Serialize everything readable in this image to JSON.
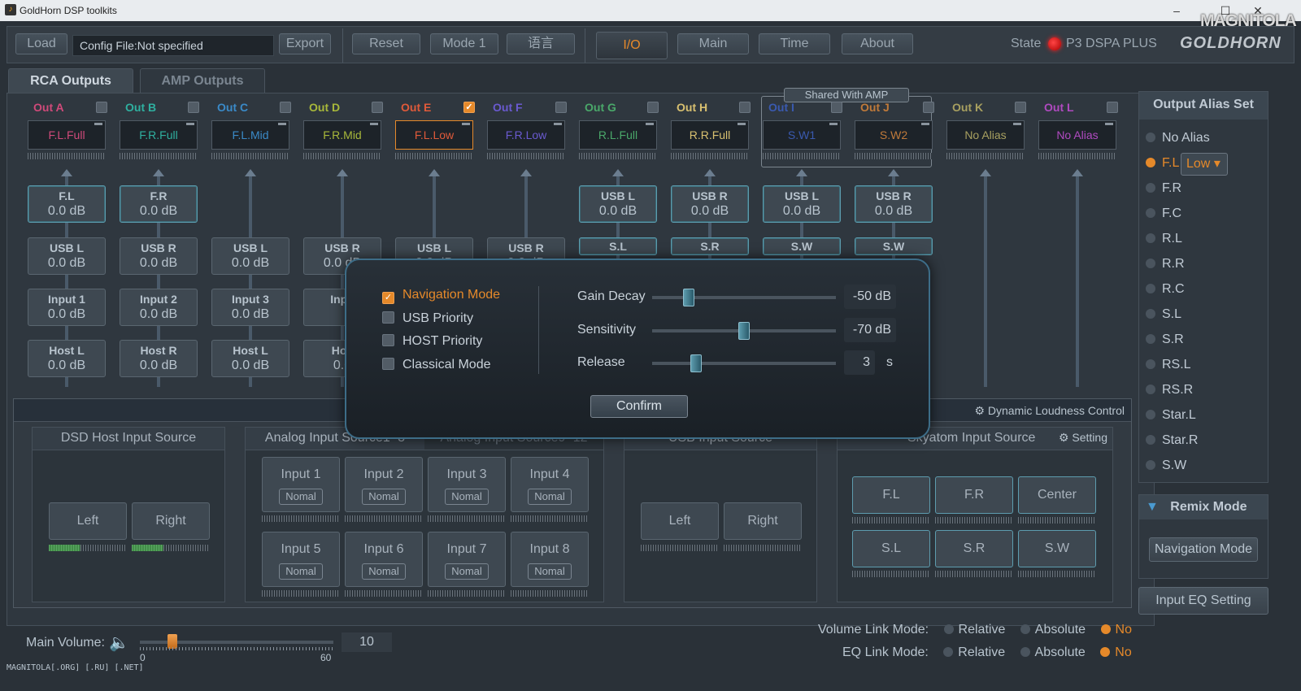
{
  "window": {
    "title": "GoldHorn DSP toolkits",
    "watermark": "MAGNITOLA"
  },
  "toolbar": {
    "load": "Load",
    "config": "Config File:Not specified",
    "export": "Export",
    "reset": "Reset",
    "mode": "Mode 1",
    "lang": "语言",
    "tabs": [
      "I/O",
      "Main",
      "Time",
      "About"
    ],
    "state_label": "State",
    "device": "P3 DSPA PLUS",
    "brand": "GOLDHORN"
  },
  "subtabs": [
    "RCA Outputs",
    "AMP Outputs"
  ],
  "shared_label": "Shared With AMP",
  "channels": [
    {
      "name": "Out  A",
      "color": "#d04a7a",
      "alias": "F.L.Full",
      "checked": false
    },
    {
      "name": "Out  B",
      "color": "#2fb0a0",
      "alias": "F.R.Full",
      "checked": false
    },
    {
      "name": "Out  C",
      "color": "#3a8ac8",
      "alias": "F.L.Mid",
      "checked": false
    },
    {
      "name": "Out  D",
      "color": "#a8b83a",
      "alias": "F.R.Mid",
      "checked": false
    },
    {
      "name": "Out  E",
      "color": "#e05a3a",
      "alias": "F.L.Low",
      "checked": true
    },
    {
      "name": "Out  F",
      "color": "#6a5ad0",
      "alias": "F.R.Low",
      "checked": false
    },
    {
      "name": "Out  G",
      "color": "#4aa86a",
      "alias": "R.L.Full",
      "checked": false
    },
    {
      "name": "Out  H",
      "color": "#d8c070",
      "alias": "R.R.Full",
      "checked": false
    },
    {
      "name": "Out  I",
      "color": "#3a5ab0",
      "alias": "S.W1",
      "checked": false
    },
    {
      "name": "Out  J",
      "color": "#c07a3a",
      "alias": "S.W2",
      "checked": false
    },
    {
      "name": "Out  K",
      "color": "#a8a060",
      "alias": "No Alias",
      "checked": false
    },
    {
      "name": "Out  L",
      "color": "#b04ac0",
      "alias": "No Alias",
      "checked": false
    }
  ],
  "sources": [
    {
      "label": "F.L",
      "value": "0.0 dB"
    },
    {
      "label": "F.R",
      "value": "0.0 dB"
    },
    {
      "label": "USB L",
      "value": "0.0 dB"
    },
    {
      "label": "USB R",
      "value": "0.0 dB"
    },
    {
      "label": "USB L",
      "value": "0.0 dB"
    },
    {
      "label": "USB R",
      "value": "0.0 dB"
    },
    {
      "label": "USB L",
      "value": "0.0 dB"
    },
    {
      "label": "USB R",
      "value": "0.0 dB"
    },
    {
      "label": "USB L",
      "value": "0.0 dB"
    },
    {
      "label": "USB R",
      "value": "0.0 dB"
    },
    {
      "label": "USB L",
      "value": "0.0 dB"
    },
    {
      "label": "USB R",
      "value": "0.0 dB"
    },
    {
      "label": "S.L",
      "value": ""
    },
    {
      "label": "S.R",
      "value": ""
    },
    {
      "label": "S.W",
      "value": ""
    },
    {
      "label": "S.W",
      "value": ""
    },
    {
      "label": "Input 1",
      "value": "0.0 dB"
    },
    {
      "label": "Input 2",
      "value": "0.0 dB"
    },
    {
      "label": "Input 3",
      "value": "0.0 dB"
    },
    {
      "label": "Inpu",
      "value": ""
    },
    {
      "label": "Host L",
      "value": "0.0 dB"
    },
    {
      "label": "Host R",
      "value": "0.0 dB"
    },
    {
      "label": "Host L",
      "value": "0.0 dB"
    },
    {
      "label": "Hos",
      "value": "0.0"
    }
  ],
  "bottom": {
    "dlc": "Dynamic Loudness Control",
    "dsd_title": "DSD Host Input Source",
    "left": "Left",
    "right": "Right",
    "analog_title": "Analog Input Source1~8",
    "analog2_title": "Analog Input Source9~12",
    "inputs": [
      "Input 1",
      "Input 2",
      "Input 3",
      "Input 4",
      "Input 5",
      "Input 6",
      "Input 7",
      "Input 8"
    ],
    "nomal": "Nomal",
    "usb_title": "USB Input Source",
    "sky_title": "Skyatom Input Source",
    "setting": "Setting",
    "sky": [
      "F.L",
      "F.R",
      "Center",
      "S.L",
      "S.R",
      "S.W"
    ]
  },
  "alias_panel": {
    "title": "Output Alias Set",
    "items": [
      "No Alias",
      "F.L",
      "F.R",
      "F.C",
      "R.L",
      "R.R",
      "R.C",
      "S.L",
      "S.R",
      "RS.L",
      "RS.R",
      "Star.L",
      "Star.R",
      "S.W"
    ],
    "selected": "F.L",
    "low": "Low"
  },
  "remix": {
    "title": "Remix Mode",
    "button": "Navigation Mode"
  },
  "eq_setting": "Input EQ Setting",
  "volume": {
    "label": "Main Volume:",
    "value": "10",
    "min": "0",
    "max": "60",
    "level": 10
  },
  "link": {
    "volume_label": "Volume Link Mode:",
    "eq_label": "EQ Link Mode:",
    "options": [
      "Relative",
      "Absolute",
      "No"
    ],
    "selected": "No"
  },
  "dialog": {
    "options": [
      {
        "label": "Navigation Mode",
        "checked": true
      },
      {
        "label": "USB Priority",
        "checked": false
      },
      {
        "label": "HOST Priority",
        "checked": false
      },
      {
        "label": "Classical Mode",
        "checked": false
      }
    ],
    "sliders": [
      {
        "label": "Gain Decay",
        "value": "-50 dB",
        "level": 0.2
      },
      {
        "label": "Sensitivity",
        "value": "-70 dB",
        "level": 0.5
      },
      {
        "label": "Release",
        "value": "3",
        "unit": "s",
        "level": 0.24
      }
    ],
    "confirm": "Confirm"
  },
  "footer": "MAGNITOLA[.ORG] [.RU] [.NET]"
}
